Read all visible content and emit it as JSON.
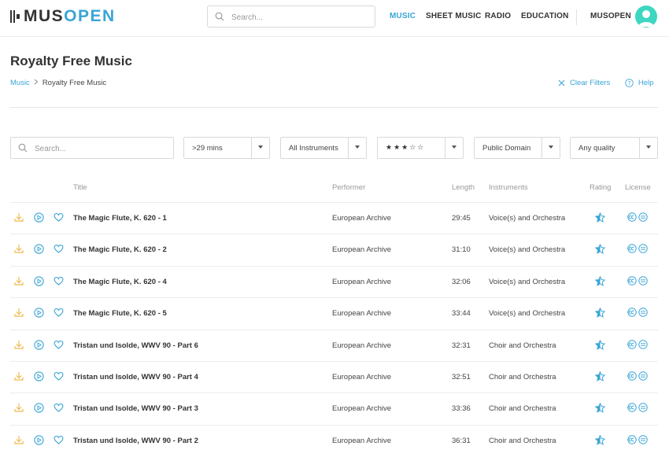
{
  "header": {
    "logo_part1": "MUS",
    "logo_part2": "OPEN",
    "search_placeholder": "Search...",
    "nav": [
      "MUSIC",
      "SHEET MUSIC",
      "RADIO",
      "EDUCATION"
    ],
    "account": "MUSOPEN"
  },
  "page": {
    "title": "Royalty Free Music",
    "breadcrumb": [
      "Music",
      "Royalty Free Music"
    ],
    "clear_filters": "Clear Filters",
    "help": "Help"
  },
  "filters": {
    "search_placeholder": "Search...",
    "length": ">29 mins",
    "instruments": "All Instruments",
    "rating": "★★★☆☆",
    "license": "Public Domain",
    "quality": "Any quality"
  },
  "table": {
    "headers": [
      "Title",
      "Performer",
      "Length",
      "Instruments",
      "Rating",
      "License"
    ],
    "rows": [
      {
        "title": "The Magic Flute, K. 620 - 1",
        "performer": "European Archive",
        "length": "29:45",
        "instruments": "Voice(s) and Orchestra"
      },
      {
        "title": "The Magic Flute, K. 620 - 2",
        "performer": "European Archive",
        "length": "31:10",
        "instruments": "Voice(s) and Orchestra"
      },
      {
        "title": "The Magic Flute, K. 620 - 4",
        "performer": "European Archive",
        "length": "32:06",
        "instruments": "Voice(s) and Orchestra"
      },
      {
        "title": "The Magic Flute, K. 620 - 5",
        "performer": "European Archive",
        "length": "33:44",
        "instruments": "Voice(s) and Orchestra"
      },
      {
        "title": "Tristan und Isolde, WWV 90 - Part 6",
        "performer": "European Archive",
        "length": "32:31",
        "instruments": "Choir and Orchestra"
      },
      {
        "title": "Tristan und Isolde, WWV 90 - Part 4",
        "performer": "European Archive",
        "length": "32:51",
        "instruments": "Choir and Orchestra"
      },
      {
        "title": "Tristan und Isolde, WWV 90 - Part 3",
        "performer": "European Archive",
        "length": "33:36",
        "instruments": "Choir and Orchestra"
      },
      {
        "title": "Tristan und Isolde, WWV 90 - Part 2",
        "performer": "European Archive",
        "length": "36:31",
        "instruments": "Choir and Orchestra"
      }
    ]
  },
  "colors": {
    "accent": "#3aa5d6",
    "download": "#f2b84b",
    "avatar": "#3dd6c1"
  },
  "icons": [
    "search-icon",
    "chevron-right-icon",
    "close-icon",
    "help-icon",
    "caret-down-icon",
    "download-icon",
    "play-icon",
    "heart-icon",
    "star-half-icon",
    "creative-commons-icon",
    "public-domain-icon",
    "user-icon"
  ]
}
